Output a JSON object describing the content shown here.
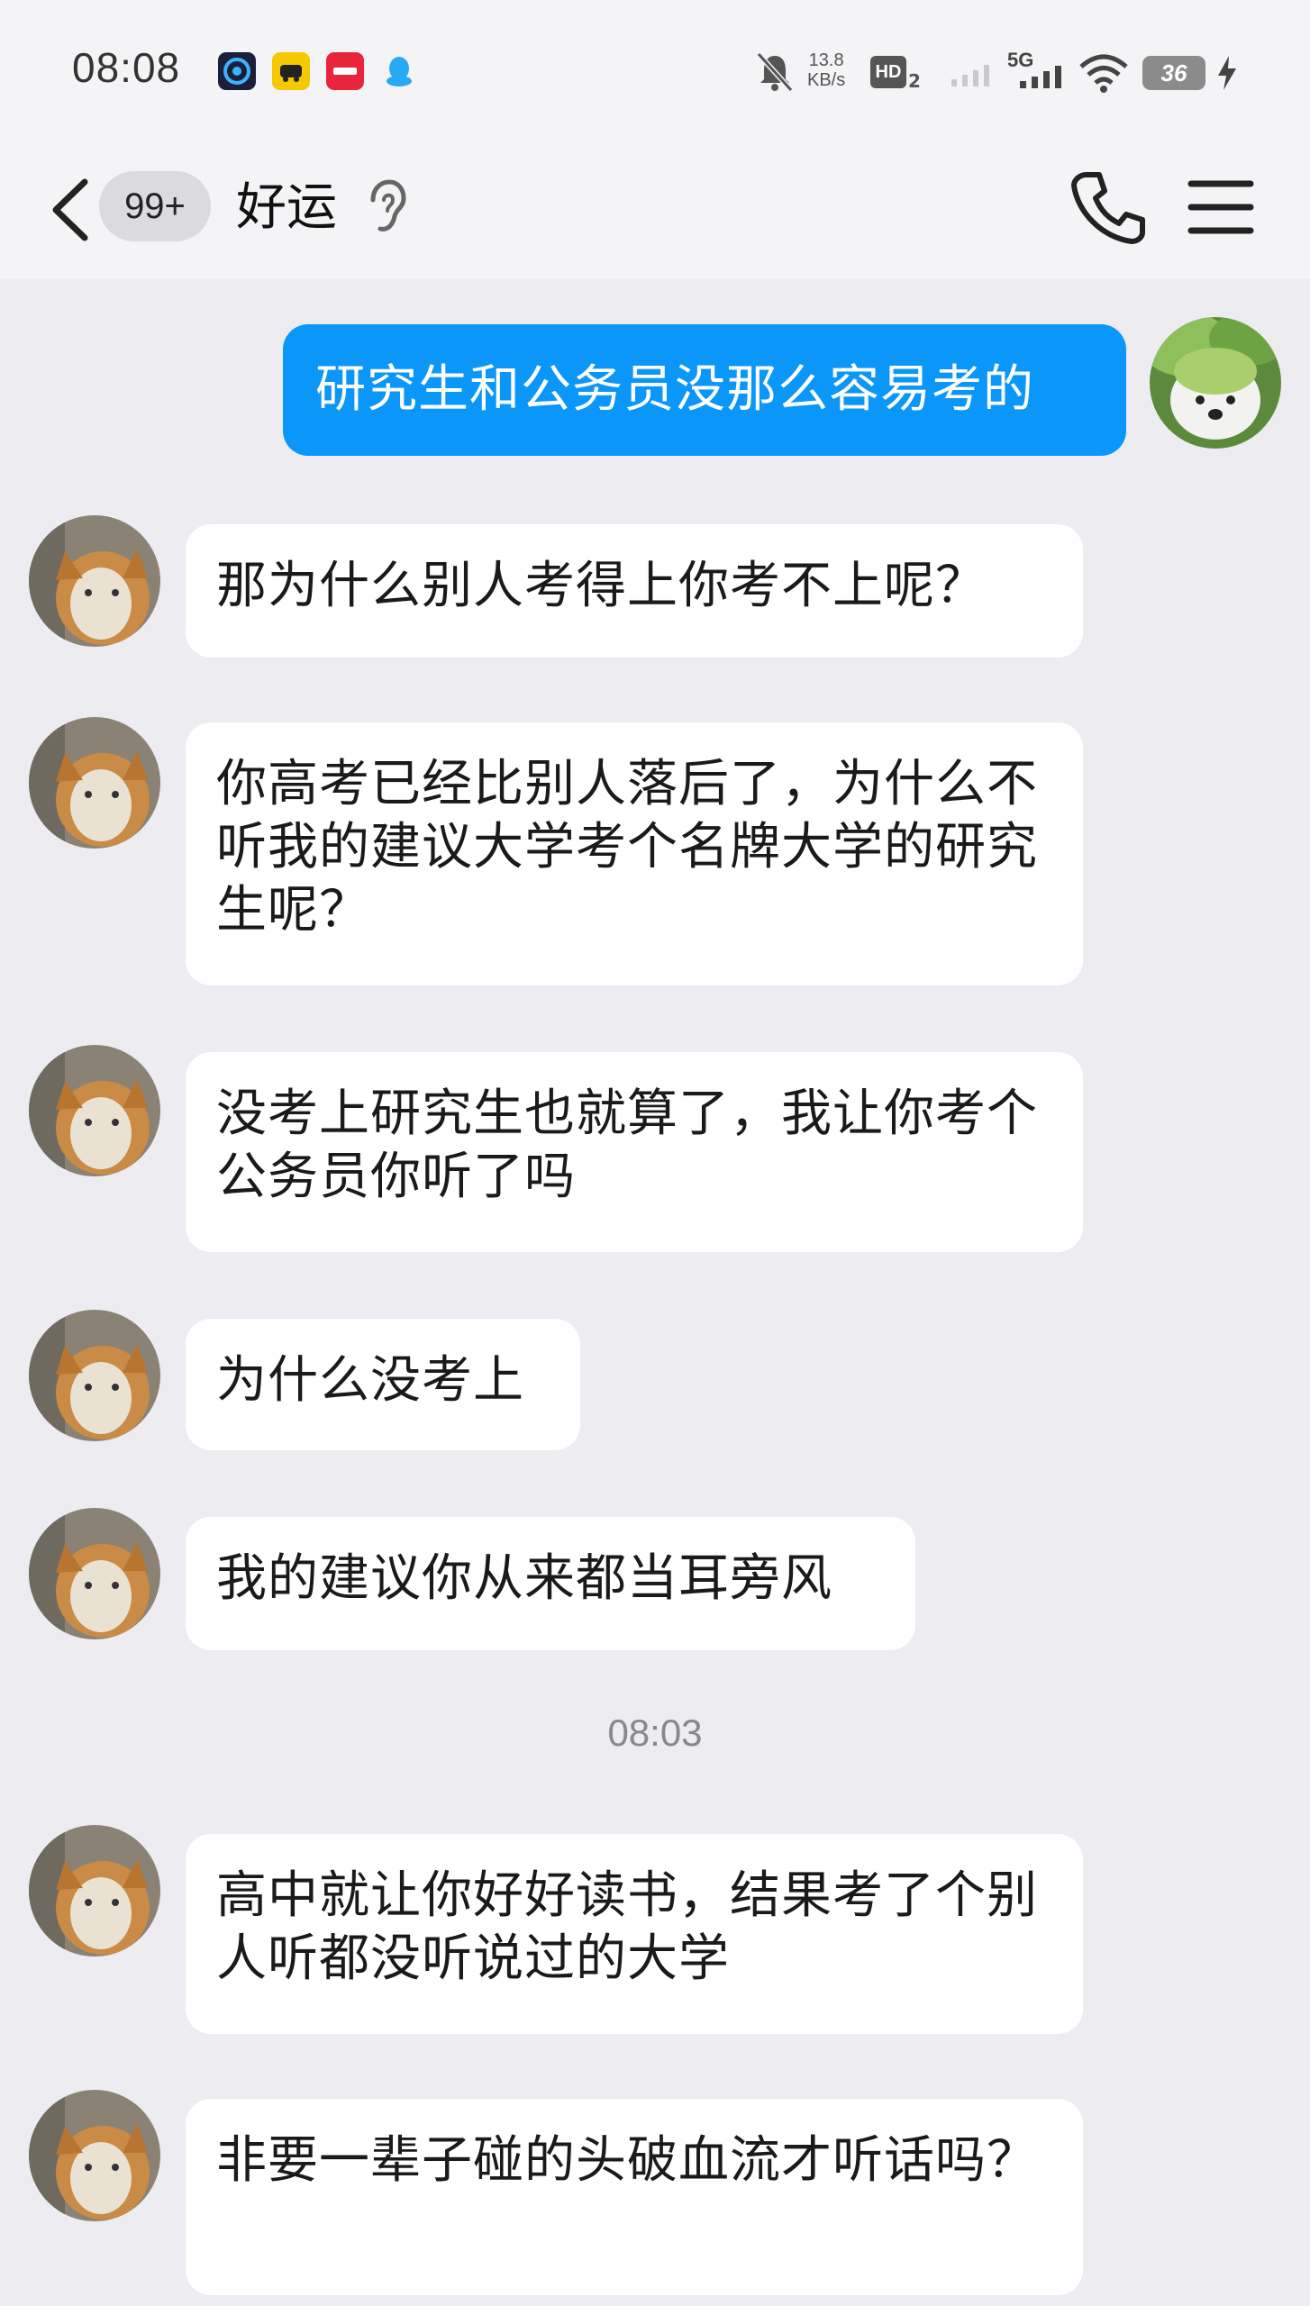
{
  "status_bar": {
    "time": "08:08",
    "net_speed_value": "13.8",
    "net_speed_unit": "KB/s",
    "hd_label": "HD",
    "hd_sub": "2",
    "signal_label": "5G",
    "battery_level": "36",
    "app_icons": [
      "video-app-icon",
      "car-app-icon",
      "red-app-icon",
      "qq-penguin-icon"
    ]
  },
  "header": {
    "unread_count": "99+",
    "contact_name": "好运",
    "colors": {
      "outgoing_bubble": "#0b96f9",
      "incoming_bubble": "#ffffff",
      "background": "#ececf1"
    }
  },
  "messages": [
    {
      "direction": "out",
      "text": "研究生和公务员没那么容易考的"
    },
    {
      "direction": "in",
      "text": "那为什么别人考得上你考不上呢？"
    },
    {
      "direction": "in",
      "text": "你高考已经比别人落后了，为什么不听我的建议大学考个名牌大学的研究生呢？"
    },
    {
      "direction": "in",
      "text": "没考上研究生也就算了，我让你考个公务员你听了吗"
    },
    {
      "direction": "in",
      "text": "为什么没考上"
    },
    {
      "direction": "in",
      "text": "我的建议你从来都当耳旁风"
    },
    {
      "direction": "in",
      "text": "高中就让你好好读书，结果考了个别人听都没听说过的大学"
    },
    {
      "direction": "in",
      "text": "非要一辈子碰的头破血流才听话吗？"
    }
  ],
  "timestamp": "08:03"
}
